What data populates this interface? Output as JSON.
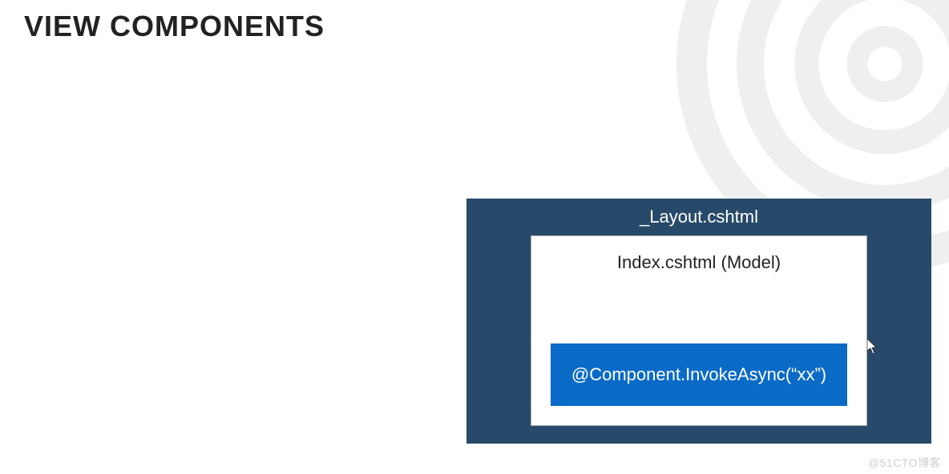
{
  "title": "VIEW COMPONENTS",
  "diagram": {
    "layout_label": "_Layout.cshtml",
    "model_label": "Index.cshtml (Model)",
    "component_call": "@Component.InvokeAsync(“xx”)"
  },
  "watermark": "@51CTO博客"
}
